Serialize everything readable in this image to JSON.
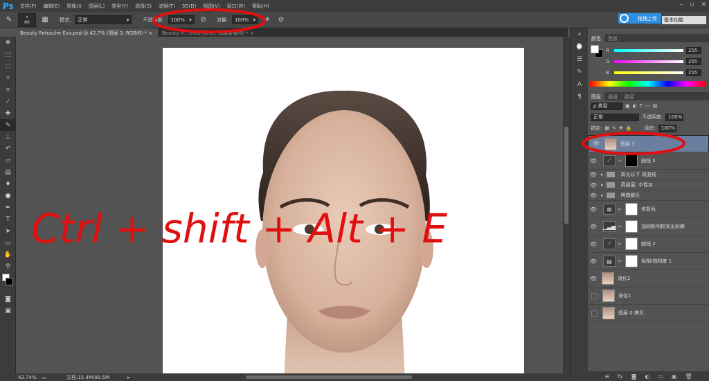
{
  "app": {
    "logo": "Ps"
  },
  "menu": [
    "文件(F)",
    "编辑(E)",
    "图像(I)",
    "图层(L)",
    "类型(Y)",
    "选择(S)",
    "滤镜(T)",
    "3D(D)",
    "视图(V)",
    "窗口(W)",
    "帮助(H)"
  ],
  "window_controls": [
    "–",
    "▫",
    "✕"
  ],
  "options": {
    "brush_size": "80",
    "mode_label": "模式:",
    "mode_value": "正常",
    "opacity_label": "不透明度:",
    "opacity_value": "100%",
    "flow_label": "流量:",
    "flow_value": "100%"
  },
  "upload_button": "拖拽上传",
  "workspace": "基本功能",
  "tabs": [
    {
      "label": "Beauty Retusche Eva.psd @ 42.7% (图层 3, RGB/8) *",
      "close": "×"
    },
    {
      "label": "Beauty R…(Hautfarbe, 图层蒙版/8) *",
      "close": "×"
    }
  ],
  "status": {
    "zoom": "42.74%",
    "doc": "文档:15.4M/89.5M"
  },
  "color_panel": {
    "tabs": [
      "颜色",
      "色板"
    ],
    "channels": [
      {
        "label": "R",
        "value": "255",
        "color": "#ff4040"
      },
      {
        "label": "G",
        "value": "255",
        "color": "#40ff40"
      },
      {
        "label": "B",
        "value": "255",
        "color": "#4060ff"
      }
    ]
  },
  "layers_panel": {
    "tabs": [
      "图层",
      "通道",
      "路径"
    ],
    "filter_label": "ρ 类型",
    "blend_mode": "正常",
    "opacity_label": "不透明度:",
    "opacity_value": "100%",
    "lock_label": "锁定:",
    "fill_label": "填充:",
    "fill_value": "100%",
    "layers": [
      {
        "name": "图层 3",
        "kind": "pixel",
        "visible": true,
        "selected": true
      },
      {
        "name": "曲线 5",
        "kind": "curves",
        "visible": true,
        "mask": "black"
      },
      {
        "name": "高光以下 双曲线",
        "kind": "group",
        "visible": true
      },
      {
        "name": "高级层, 中性灰",
        "kind": "group",
        "visible": true
      },
      {
        "name": "明暗脚头",
        "kind": "group",
        "visible": true
      },
      {
        "name": "修复色",
        "kind": "adjustment",
        "visible": true
      },
      {
        "name": "加同影响枚突出轮廓",
        "kind": "levels",
        "visible": true
      },
      {
        "name": "曲线 2",
        "kind": "curves",
        "visible": true
      },
      {
        "name": "色相/饱和度 1",
        "kind": "huesat",
        "visible": true
      },
      {
        "name": "液化2",
        "kind": "pixel",
        "visible": true
      },
      {
        "name": "液化1",
        "kind": "pixel",
        "visible": false
      },
      {
        "name": "图层 0 拷贝",
        "kind": "pixel",
        "visible": false
      }
    ],
    "footer_icons": [
      "⊖",
      "fx",
      "◙",
      "◐",
      "▭",
      "▣",
      "🗑"
    ]
  },
  "annotation": {
    "handwritten_text": "Ctrl + shift + Alt + E",
    "color": "#e01010"
  },
  "accent": "#31a8ff"
}
